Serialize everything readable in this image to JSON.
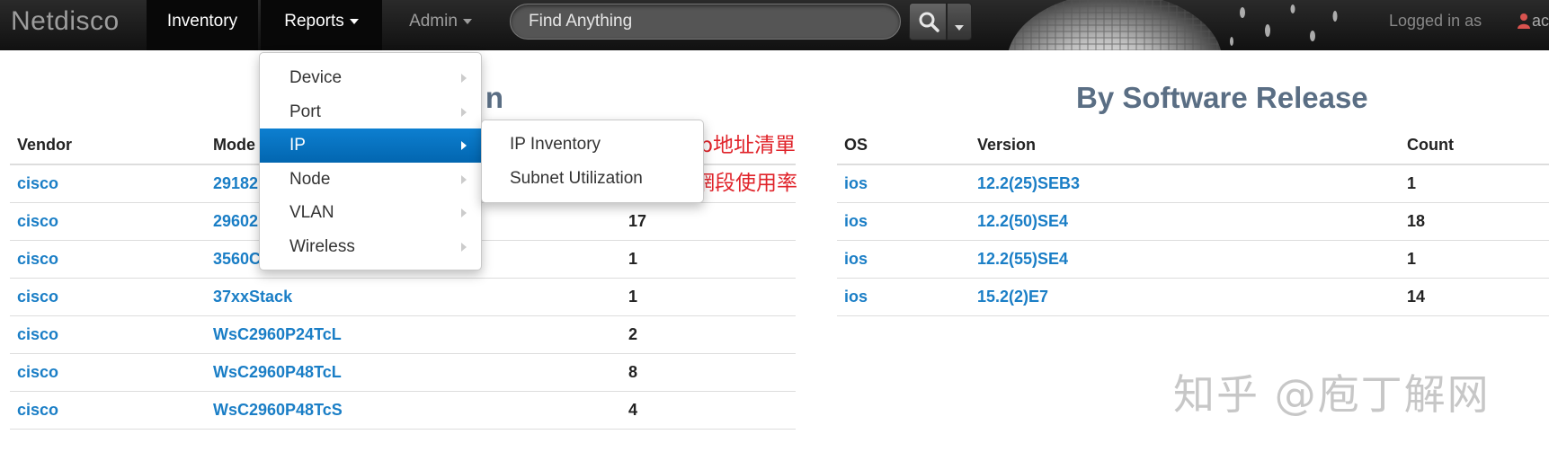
{
  "navbar": {
    "brand": "Netdisco",
    "items": [
      {
        "label": "Inventory"
      },
      {
        "label": "Reports"
      },
      {
        "label": "Admin"
      }
    ],
    "search_value": "Find Anything",
    "logged_in_text": "Logged in as",
    "user_partial": "ac"
  },
  "sections": {
    "left_title_partial": "n",
    "right_title": "By Software Release"
  },
  "vendor_table": {
    "headers": [
      "Vendor",
      "Mode",
      ""
    ],
    "rows": [
      {
        "vendor": "cisco",
        "model": "29182",
        "count": ""
      },
      {
        "vendor": "cisco",
        "model": "29602",
        "count": "17"
      },
      {
        "vendor": "cisco",
        "model": "3560C",
        "count": "1"
      },
      {
        "vendor": "cisco",
        "model": "37xxStack",
        "count": "1"
      },
      {
        "vendor": "cisco",
        "model": "WsC2960P24TcL",
        "count": "2"
      },
      {
        "vendor": "cisco",
        "model": "WsC2960P48TcL",
        "count": "8"
      },
      {
        "vendor": "cisco",
        "model": "WsC2960P48TcS",
        "count": "4"
      }
    ]
  },
  "release_table": {
    "headers": [
      "OS",
      "Version",
      "Count"
    ],
    "rows": [
      {
        "os": "ios",
        "version": "12.2(25)SEB3",
        "count": "1"
      },
      {
        "os": "ios",
        "version": "12.2(50)SE4",
        "count": "18"
      },
      {
        "os": "ios",
        "version": "12.2(55)SE4",
        "count": "1"
      },
      {
        "os": "ios",
        "version": "15.2(2)E7",
        "count": "14"
      }
    ]
  },
  "reports_menu": {
    "items": [
      {
        "label": "Device"
      },
      {
        "label": "Port"
      },
      {
        "label": "IP"
      },
      {
        "label": "Node"
      },
      {
        "label": "VLAN"
      },
      {
        "label": "Wireless"
      }
    ],
    "active_item": "IP",
    "ip_submenu": [
      {
        "label": "IP Inventory"
      },
      {
        "label": "Subnet Utilization"
      }
    ]
  },
  "annotations": {
    "ip_inventory_note": "ip地址清單",
    "subnet_note": "網段使用率"
  },
  "watermark": "知乎 @庖丁解网",
  "colors": {
    "navbar_bg": "#1b1b1b",
    "link": "#1a7ec6",
    "menu_active": "#0773c3",
    "title": "#5a6e84",
    "annotation": "#e0232a"
  }
}
